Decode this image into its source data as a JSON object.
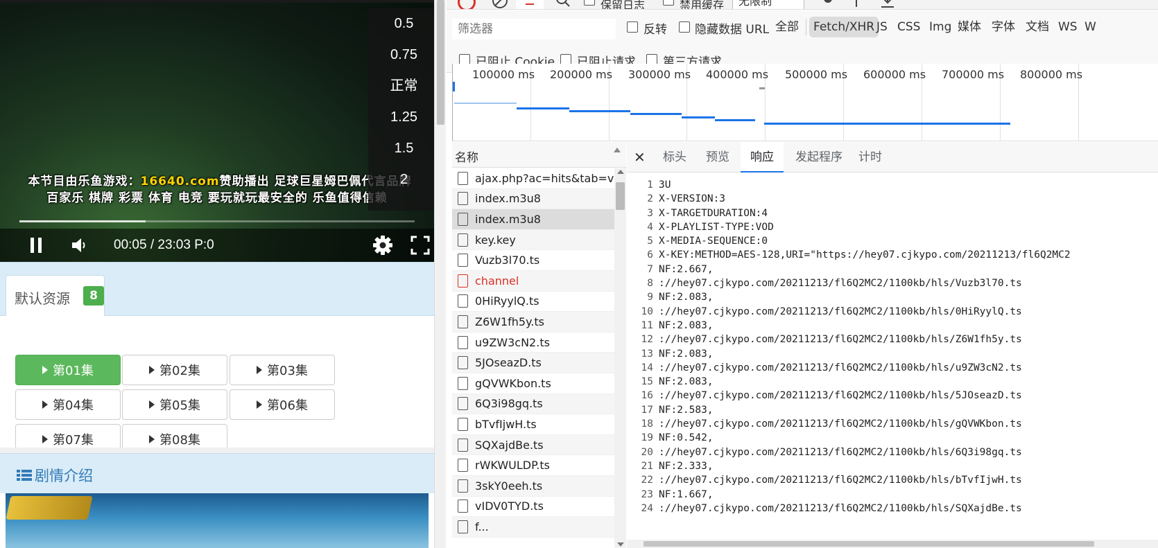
{
  "player": {
    "ad_line1_a": "本节目由乐鱼游戏：",
    "ad_line1_hl": "16640.com",
    "ad_line1_b": "赞助播出 足球巨星姆巴佩代言品牌",
    "ad_line2": "百家乐 棋牌 彩票 体育 电竞 要玩就玩最安全的 乐鱼值得信赖",
    "time_display": "00:05 / 23:03 P:0",
    "progress": 0.32,
    "speed_options": [
      "0.5",
      "0.75",
      "正常",
      "1.25",
      "1.5",
      "2"
    ]
  },
  "resources": {
    "tab_label": "默认资源",
    "count": "8",
    "episodes": [
      "第01集",
      "第02集",
      "第03集",
      "第04集",
      "第05集",
      "第06集",
      "第07集",
      "第08集"
    ],
    "active_episode": "第01集"
  },
  "synopsis": {
    "title": "剧情介绍"
  },
  "devtools": {
    "toolbar": {
      "preserve_log": "保留日志",
      "disable_cache": "禁用缓存",
      "throttle": "无限制"
    },
    "filter": {
      "placeholder": "筛选器",
      "invert": "反转",
      "hide_data_urls": "隐藏数据 URL",
      "types": [
        "全部",
        "Fetch/XHR",
        "JS",
        "CSS",
        "Img",
        "媒体",
        "字体",
        "文档",
        "WS",
        "W"
      ],
      "selected_type": "Fetch/XHR",
      "blocked_cookies": "已阻止 Cookie",
      "blocked_requests": "已阻止请求",
      "third_party": "第三方请求"
    },
    "overview": {
      "ticks": [
        "100000 ms",
        "200000 ms",
        "300000 ms",
        "400000 ms",
        "500000 ms",
        "600000 ms",
        "700000 ms",
        "800000 ms"
      ]
    },
    "names_header": "名称",
    "requests": [
      {
        "name": "ajax.php?ac=hits&tab=vo..."
      },
      {
        "name": "index.m3u8"
      },
      {
        "name": "index.m3u8",
        "selected": true
      },
      {
        "name": "key.key"
      },
      {
        "name": "Vuzb3l70.ts"
      },
      {
        "name": "channel",
        "error": true
      },
      {
        "name": "0HiRyylQ.ts"
      },
      {
        "name": "Z6W1fh5y.ts"
      },
      {
        "name": "u9ZW3cN2.ts"
      },
      {
        "name": "5JOseazD.ts"
      },
      {
        "name": "gQVWKbon.ts"
      },
      {
        "name": "6Q3i98gq.ts"
      },
      {
        "name": "bTvfIjwH.ts"
      },
      {
        "name": "SQXajdBe.ts"
      },
      {
        "name": "rWKWULDP.ts"
      },
      {
        "name": "3skY0eeh.ts"
      },
      {
        "name": "vIDV0TYD.ts"
      },
      {
        "name": "f..."
      }
    ],
    "detail_tabs": [
      "标头",
      "预览",
      "响应",
      "发起程序",
      "计时"
    ],
    "selected_detail_tab": "响应",
    "response_lines": [
      "3U",
      "X-VERSION:3",
      "X-TARGETDURATION:4",
      "X-PLAYLIST-TYPE:VOD",
      "X-MEDIA-SEQUENCE:0",
      "X-KEY:METHOD=AES-128,URI=\"https://hey07.cjkypo.com/20211213/fl6Q2MC2",
      "NF:2.667,",
      "://hey07.cjkypo.com/20211213/fl6Q2MC2/1100kb/hls/Vuzb3l70.ts",
      "NF:2.083,",
      "://hey07.cjkypo.com/20211213/fl6Q2MC2/1100kb/hls/0HiRyylQ.ts",
      "NF:2.083,",
      "://hey07.cjkypo.com/20211213/fl6Q2MC2/1100kb/hls/Z6W1fh5y.ts",
      "NF:2.083,",
      "://hey07.cjkypo.com/20211213/fl6Q2MC2/1100kb/hls/u9ZW3cN2.ts",
      "NF:2.083,",
      "://hey07.cjkypo.com/20211213/fl6Q2MC2/1100kb/hls/5JOseazD.ts",
      "NF:2.583,",
      "://hey07.cjkypo.com/20211213/fl6Q2MC2/1100kb/hls/gQVWKbon.ts",
      "NF:0.542,",
      "://hey07.cjkypo.com/20211213/fl6Q2MC2/1100kb/hls/6Q3i98gq.ts",
      "NF:2.333,",
      "://hey07.cjkypo.com/20211213/fl6Q2MC2/1100kb/hls/bTvfIjwH.ts",
      "NF:1.667,",
      "://hey07.cjkypo.com/20211213/fl6Q2MC2/1100kb/hls/SQXajdBe.ts"
    ]
  }
}
